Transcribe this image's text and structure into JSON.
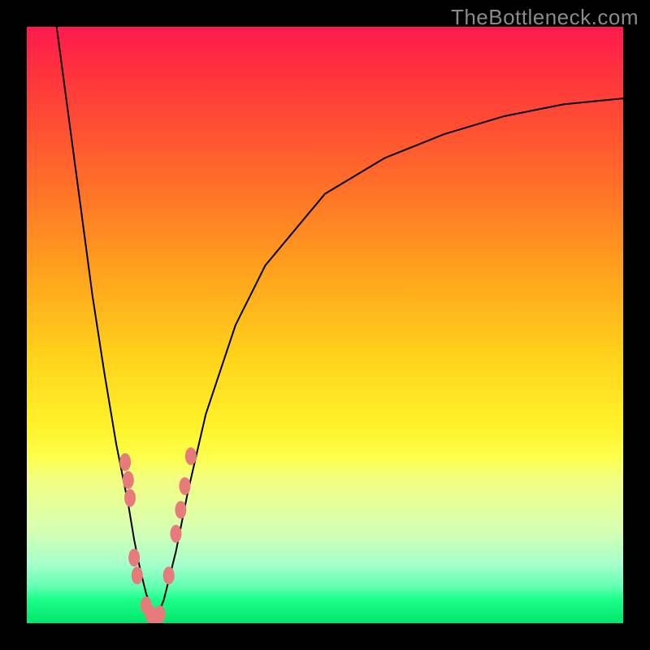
{
  "watermark": "TheBottleneck.com",
  "colors": {
    "frame": "#000000",
    "marker": "#e77a7a",
    "curve": "#000000"
  },
  "chart_data": {
    "type": "line",
    "title": "",
    "xlabel": "",
    "ylabel": "",
    "xlim": [
      0,
      100
    ],
    "ylim": [
      0,
      100
    ],
    "grid": false,
    "x_optimal": 21.5,
    "series": [
      {
        "name": "left-branch",
        "x": [
          5,
          7,
          9,
          11,
          13,
          15,
          17,
          18,
          19,
          20,
          21,
          21.5
        ],
        "y": [
          100,
          85,
          70,
          55,
          42,
          30,
          20,
          14,
          9,
          5,
          2,
          0
        ]
      },
      {
        "name": "right-branch",
        "x": [
          21.5,
          23,
          25,
          27,
          30,
          35,
          40,
          50,
          60,
          70,
          80,
          90,
          100
        ],
        "y": [
          0,
          4,
          12,
          22,
          35,
          50,
          60,
          72,
          78,
          82,
          85,
          87,
          88
        ]
      }
    ],
    "markers": {
      "name": "highlighted-points",
      "points": [
        {
          "x": 16.5,
          "y": 27
        },
        {
          "x": 17.0,
          "y": 24
        },
        {
          "x": 17.3,
          "y": 21
        },
        {
          "x": 18.0,
          "y": 11
        },
        {
          "x": 18.5,
          "y": 8
        },
        {
          "x": 20.0,
          "y": 3
        },
        {
          "x": 20.8,
          "y": 1.5
        },
        {
          "x": 21.5,
          "y": 0.5
        },
        {
          "x": 22.3,
          "y": 1.5
        },
        {
          "x": 23.8,
          "y": 8
        },
        {
          "x": 25.0,
          "y": 15
        },
        {
          "x": 25.8,
          "y": 19
        },
        {
          "x": 26.5,
          "y": 23
        },
        {
          "x": 27.5,
          "y": 28
        }
      ]
    },
    "background_gradient": [
      {
        "pos": 0.0,
        "color": "#ff1a4d"
      },
      {
        "pos": 0.5,
        "color": "#ffd21a"
      },
      {
        "pos": 0.95,
        "color": "#1cff8a"
      },
      {
        "pos": 1.0,
        "color": "#00e66a"
      }
    ]
  }
}
